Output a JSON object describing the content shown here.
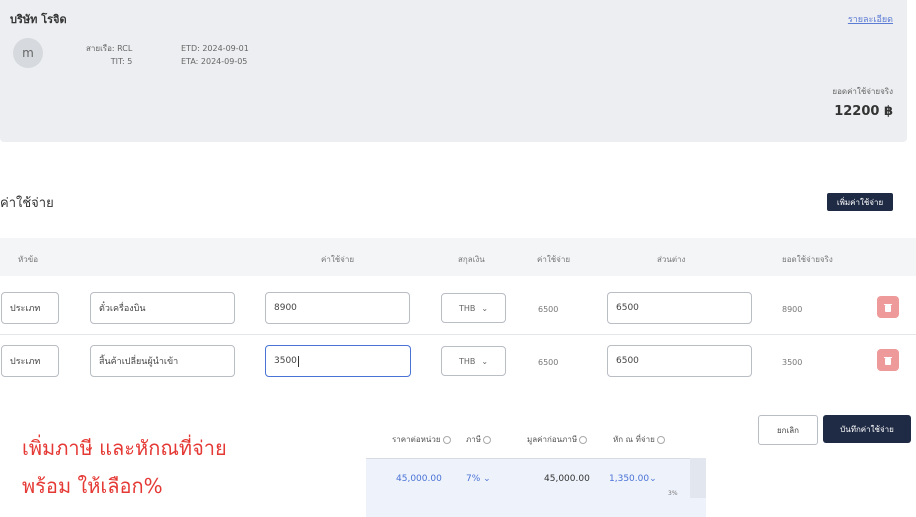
{
  "header": {
    "company": "บริษัท โรจิด",
    "detail_link": "รายละเอียด",
    "avatar_initial": "m",
    "line": "สายเรือ: RCL",
    "tit": "TIT: 5",
    "etd": "ETD: 2024-09-01",
    "eta": "ETA: 2024-09-05",
    "net_label": "ยอดค่าใช้จ่ายจริง",
    "net_value": "12200 ฿"
  },
  "expenses": {
    "title": "ค่าใช้จ่าย",
    "add_button": "เพิ่มค่าใช้จ่าย",
    "columns": [
      "หัวข้อ",
      "ค่าใช้จ่าย",
      "สกุลเงิน",
      "ค่าใช้จ่าย",
      "ส่วนต่าง",
      "ยอดใช้จ่ายจริง"
    ],
    "rows": [
      {
        "category": "ประเภท",
        "name": "ตั๋วเครื่องบิน",
        "amount": "8900",
        "currency": "THB",
        "budget": "6500",
        "diff": "6500",
        "actual": "8900"
      },
      {
        "category": "ประเภท",
        "name": "สิ้นค้าเปลี่ยนผู้นำเข้า",
        "amount": "3500",
        "currency": "THB",
        "budget": "6500",
        "diff": "6500",
        "actual": "3500"
      }
    ]
  },
  "annotation": {
    "line1": "เพิ่มภาษี และหักณที่จ่าย",
    "line2": "พร้อม ให้เลือก%"
  },
  "tax": {
    "headers": [
      "ราคาต่อหน่วย",
      "ภาษี",
      "มูลค่าก่อนภาษี",
      "หัก ณ ที่จ่าย"
    ],
    "unit_price": "45,000.00",
    "vat": "7%",
    "pre_tax": "45,000.00",
    "withholding": "1,350.00",
    "withholding_rate": "3%"
  },
  "actions": {
    "cancel": "ยกเลิก",
    "save": "บันทึกค่าใช้จ่าย"
  },
  "colors": {
    "primary": "#1f2a44",
    "link": "#5b7bd5",
    "annotation": "#e53935",
    "danger": "#ef9a9a"
  }
}
